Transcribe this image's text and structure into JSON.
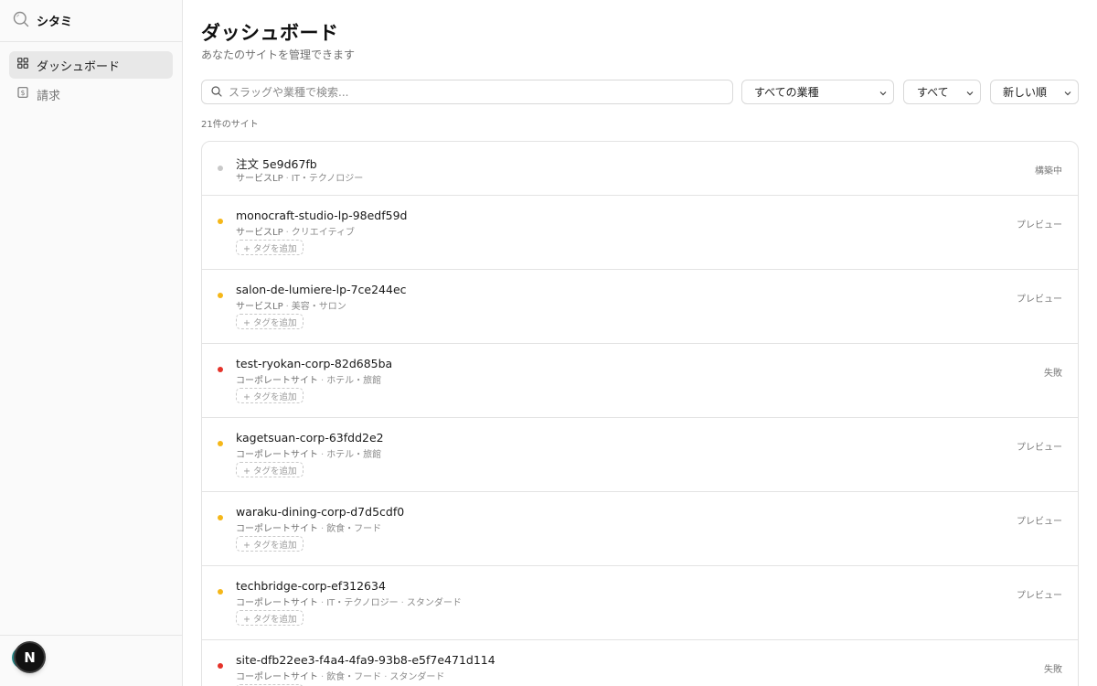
{
  "app": {
    "name": "シタミ"
  },
  "sidebar": {
    "items": [
      {
        "label": "ダッシュボード",
        "icon": "dashboard-grid-icon",
        "active": true
      },
      {
        "label": "請求",
        "icon": "invoice-icon",
        "active": false
      }
    ],
    "user": {
      "avatar_letter": "N"
    }
  },
  "header": {
    "title": "ダッシュボード",
    "subtitle": "あなたのサイトを管理できます"
  },
  "filters": {
    "search_placeholder": "スラッグや業種で検索...",
    "industry": "すべての業種",
    "status": "すべて",
    "order": "新しい順"
  },
  "count_text": "21件のサイト",
  "tag_add_label": "+ タグを追加",
  "colors": {
    "building": "#c9c9c9",
    "preview": "#f5b719",
    "failed": "#e5332a"
  },
  "sites": [
    {
      "name": "注文 5e9d67fb",
      "type": "サービスLP",
      "industry": "IT・テクノロジー",
      "extra": "",
      "status": "構築中",
      "dot_color": "#c9c9c9",
      "tag_button": false
    },
    {
      "name": "monocraft-studio-lp-98edf59d",
      "type": "サービスLP",
      "industry": "クリエイティブ",
      "extra": "",
      "status": "プレビュー",
      "dot_color": "#f5b719",
      "tag_button": true
    },
    {
      "name": "salon-de-lumiere-lp-7ce244ec",
      "type": "サービスLP",
      "industry": "美容・サロン",
      "extra": "",
      "status": "プレビュー",
      "dot_color": "#f5b719",
      "tag_button": true
    },
    {
      "name": "test-ryokan-corp-82d685ba",
      "type": "コーポレートサイト",
      "industry": "ホテル・旅館",
      "extra": "",
      "status": "失敗",
      "dot_color": "#e5332a",
      "tag_button": true
    },
    {
      "name": "kagetsuan-corp-63fdd2e2",
      "type": "コーポレートサイト",
      "industry": "ホテル・旅館",
      "extra": "",
      "status": "プレビュー",
      "dot_color": "#f5b719",
      "tag_button": true
    },
    {
      "name": "waraku-dining-corp-d7d5cdf0",
      "type": "コーポレートサイト",
      "industry": "飲食・フード",
      "extra": "",
      "status": "プレビュー",
      "dot_color": "#f5b719",
      "tag_button": true
    },
    {
      "name": "techbridge-corp-ef312634",
      "type": "コーポレートサイト",
      "industry": "IT・テクノロジー",
      "extra": "スタンダード",
      "status": "プレビュー",
      "dot_color": "#f5b719",
      "tag_button": true
    },
    {
      "name": "site-dfb22ee3-f4a4-4fa9-93b8-e5f7e471d114",
      "type": "コーポレートサイト",
      "industry": "飲食・フード",
      "extra": "スタンダード",
      "status": "失敗",
      "dot_color": "#e5332a",
      "tag_button": true
    }
  ]
}
